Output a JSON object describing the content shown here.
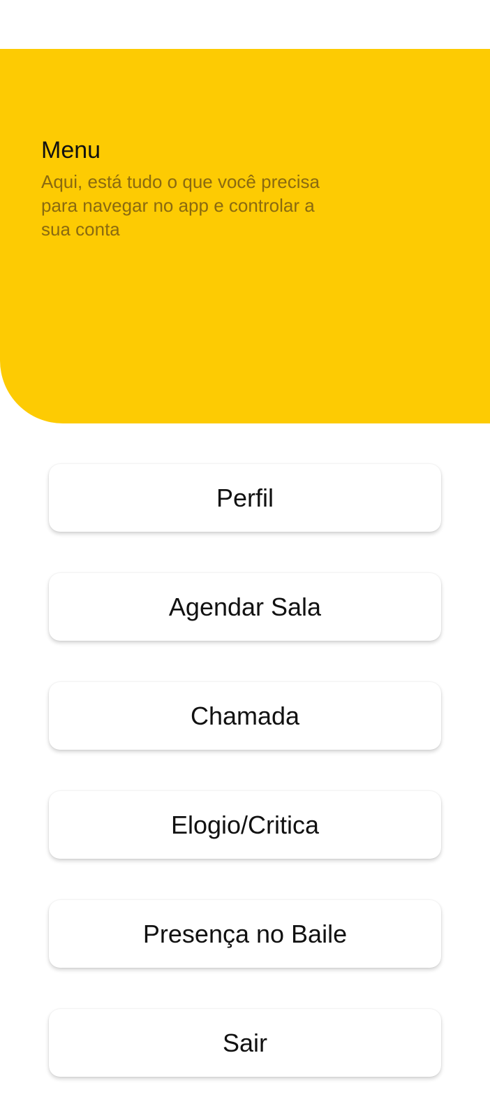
{
  "header": {
    "title": "Menu",
    "subtitle": "Aqui, está tudo o que você precisa para navegar no app e controlar a sua conta",
    "background_color": "#FDCB03"
  },
  "menu": {
    "items": [
      {
        "label": "Perfil"
      },
      {
        "label": "Agendar Sala"
      },
      {
        "label": "Chamada"
      },
      {
        "label": "Elogio/Critica"
      },
      {
        "label": "Presença no Baile"
      },
      {
        "label": "Sair"
      }
    ]
  }
}
